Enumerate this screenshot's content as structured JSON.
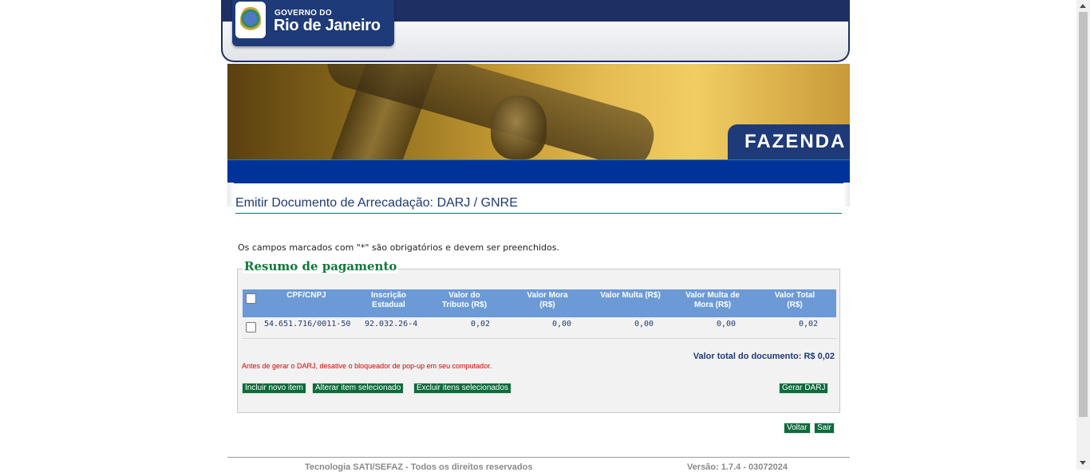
{
  "header": {
    "logo_small": "GOVERNO DO",
    "logo_big": "Rio de Janeiro",
    "section": "FAZENDA"
  },
  "page": {
    "title": "Emitir Documento de Arrecadação: DARJ / GNRE",
    "required_note": "Os campos marcados com \"*\" são obrigatórios e devem ser preenchidos."
  },
  "summary": {
    "legend": "Resumo de pagamento",
    "columns": [
      "CPF/CNPJ",
      "Inscrição Estadual",
      "Valor do Tributo (R$)",
      "Valor Mora (R$)",
      "Valor Multa (R$)",
      "Valor Multa de Mora (R$)",
      "Valor Total (R$)"
    ],
    "rows": [
      {
        "cpf_cnpj": "54.651.716/0011-50",
        "inscricao": "92.032.26-4",
        "valor_tributo": "0,02",
        "valor_mora": "0,00",
        "valor_multa": "0,00",
        "valor_multa_mora": "0,00",
        "valor_total": "0,02"
      }
    ],
    "total_label": "Valor total do documento: R$ 0,02",
    "warning": "Antes de gerar o DARJ, desative o bloqueador de pop-up em seu computador.",
    "buttons": {
      "incluir": "Incluir novo item",
      "alterar": "Alterar item selecionado",
      "excluir": "Excluir itens selecionados",
      "gerar": "Gerar DARJ"
    }
  },
  "nav": {
    "voltar": "Voltar",
    "sair": "Sair"
  },
  "footer": {
    "left": "Tecnologia SATI/SEFAZ - Todos os direitos reservados",
    "right": "Versão: 1.7.4 - 03072024"
  },
  "colors": {
    "navy": "#1e2f63",
    "blue_bar": "#003399",
    "table_header": "#6b9ad7",
    "button_green": "#0d6b3c",
    "warning_red": "#d40000"
  }
}
